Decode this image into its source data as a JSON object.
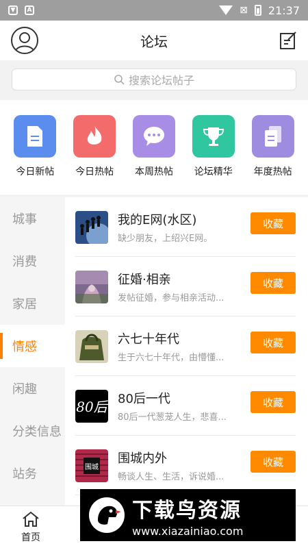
{
  "statusbar": {
    "time": "21:37",
    "icons": [
      "shield-icon",
      "a-icon"
    ]
  },
  "header": {
    "title": "论坛"
  },
  "search": {
    "placeholder": "搜索论坛帖子"
  },
  "categories": [
    {
      "label": "今日新帖",
      "color": "#5b8def",
      "icon": "document-icon"
    },
    {
      "label": "今日热帖",
      "color": "#f46b6b",
      "icon": "flame-icon"
    },
    {
      "label": "本周热帖",
      "color": "#a88de6",
      "icon": "chat-icon"
    },
    {
      "label": "论坛精华",
      "color": "#2fc6a0",
      "icon": "trophy-icon"
    },
    {
      "label": "年度热帖",
      "color": "#9d8ce0",
      "icon": "files-icon"
    }
  ],
  "sidebar": {
    "items": [
      {
        "label": "城事"
      },
      {
        "label": "消费"
      },
      {
        "label": "家居"
      },
      {
        "label": "情感",
        "active": true
      },
      {
        "label": "闲趣"
      },
      {
        "label": "分类信息"
      },
      {
        "label": "站务"
      }
    ]
  },
  "forums": [
    {
      "name": "我的E网(水区)",
      "desc": "缺少朋友，上绍兴E网。",
      "button": "收藏"
    },
    {
      "name": "征婚·相亲",
      "desc": "发帖征婚，参与相亲活动...",
      "button": "收藏"
    },
    {
      "name": "六七十年代",
      "desc": "生于六七十年代，由懵懂...",
      "button": "收藏"
    },
    {
      "name": "80后一代",
      "desc": "80后一代葱茏人生，悲喜...",
      "button": "收藏"
    },
    {
      "name": "围城内外",
      "desc": "畅谈人生、生活，诉说婚...",
      "button": "收藏"
    }
  ],
  "bottomnav": {
    "home_label": "首页"
  },
  "watermark": {
    "title": "下载鸟资源",
    "url": "www.xiazainiao.com"
  },
  "colors": {
    "accent": "#ff8a00",
    "sidebar_active": "#ff7f00"
  }
}
